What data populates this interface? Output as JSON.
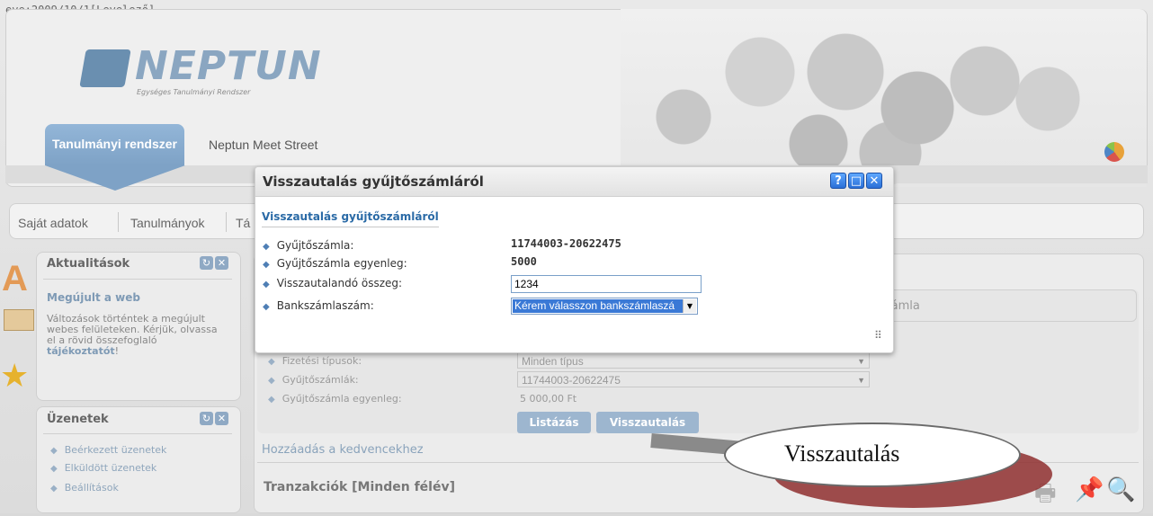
{
  "top_strip_text": "eve:2009/10/1[Levelező]",
  "logo": {
    "name": "NEPTUN",
    "subtitle": "Egységes Tanulmányi Rendszer"
  },
  "header_tabs": {
    "active": "Tanulmányi rendszer",
    "other": "Neptun Meet Street"
  },
  "menu": [
    "Saját adatok",
    "Tanulmányok",
    "Tá"
  ],
  "sidebar": {
    "news": {
      "title": "Aktualitások",
      "item_title": "Megújult a web",
      "item_body": "Változások történtek a megújult webes felületeken. Kérjük, olvassa el a rövid összefoglaló",
      "item_link": "tájékoztatót",
      "item_suffix": "!"
    },
    "messages": {
      "title": "Üzenetek",
      "items": [
        "Beérkezett üzenetek",
        "Elküldött üzenetek",
        "Beállítások"
      ]
    }
  },
  "main": {
    "right_tab": "számla",
    "filters": [
      {
        "label": "Fizetési típusok:",
        "value": "Minden típus"
      },
      {
        "label": "Gyűjtőszámlák:",
        "value": "11744003-20622475"
      },
      {
        "label": "Gyűjtőszámla egyenleg:",
        "value": "5 000,00 Ft"
      }
    ],
    "buttons": {
      "list": "Listázás",
      "refund": "Visszautalás"
    },
    "favorites_link": "Hozzáadás a kedvencekhez",
    "transactions_title": "Tranzakciók [Minden félév]"
  },
  "dialog": {
    "title": "Visszautalás gyűjtőszámláról",
    "section_title": "Visszautalás gyűjtőszámláról",
    "fields": {
      "account_label": "Gyűjtőszámla:",
      "account_value": "11744003-20622475",
      "balance_label": "Gyűjtőszámla egyenleg:",
      "balance_value": "5000",
      "amount_label": "Visszautalandó összeg:",
      "amount_value": "1234",
      "bank_label": "Bankszámlaszám:",
      "bank_selected": "Kérem válasszon bankszámlaszá"
    },
    "window_buttons": {
      "help": "?",
      "maximize": "□",
      "close": "✕"
    }
  },
  "callout": {
    "text": "Visszautalás"
  },
  "colors": {
    "accent": "#2a6aa6",
    "select_highlight": "#3a79d6",
    "callout_shadow": "#8f2f2f"
  }
}
